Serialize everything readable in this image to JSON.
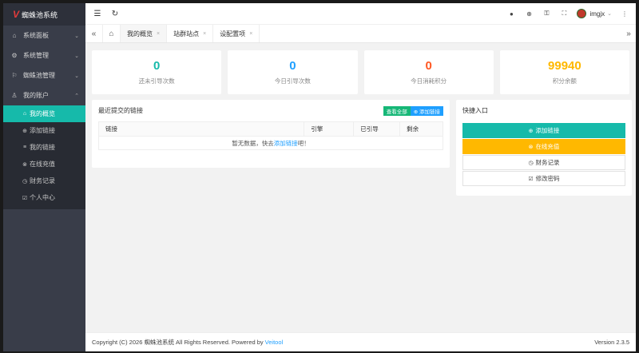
{
  "brand": {
    "logo_mark": "V",
    "name": "蜘蛛池系统"
  },
  "sidebar": {
    "items": [
      {
        "icon": "home-icon",
        "glyph": "⌂",
        "label": "系统面板",
        "arrow": "⌄"
      },
      {
        "icon": "gear-icon",
        "glyph": "⚙",
        "label": "系统管理",
        "arrow": "⌄"
      },
      {
        "icon": "flag-icon",
        "glyph": "⚐",
        "label": "蜘蛛池管理",
        "arrow": "⌄"
      },
      {
        "icon": "user-icon",
        "glyph": "♙",
        "label": "我的账户",
        "arrow": "⌃"
      }
    ],
    "sub_items": [
      {
        "glyph": "⌂",
        "label": "我的概览",
        "active": true
      },
      {
        "glyph": "⊕",
        "label": "添加链接"
      },
      {
        "glyph": "≡",
        "label": "我的链接"
      },
      {
        "glyph": "⊗",
        "label": "在线充值"
      },
      {
        "glyph": "◷",
        "label": "财务记录"
      },
      {
        "glyph": "☑",
        "label": "个人中心"
      }
    ]
  },
  "topbar": {
    "menu_glyph": "☰",
    "refresh_glyph": "↻",
    "right_icons": [
      "●",
      "⊕",
      "⚿",
      "⛶"
    ],
    "username": "imgjx",
    "more_glyph": "⋮"
  },
  "tabs": {
    "left_ctrl": "«",
    "home_glyph": "⌂",
    "items": [
      {
        "label": "我的概览",
        "active": true
      },
      {
        "label": "站群站点"
      },
      {
        "label": "设配置项"
      }
    ],
    "close_glyph": "×",
    "right_ctrl": "»"
  },
  "stats": [
    {
      "value": "0",
      "caption": "还未引导次数",
      "color": "#16baaa"
    },
    {
      "value": "0",
      "caption": "今日引导次数",
      "color": "#1e9fff"
    },
    {
      "value": "0",
      "caption": "今日消耗积分",
      "color": "#ff5722"
    },
    {
      "value": "99940",
      "caption": "积分余额",
      "color": "#ffb800"
    }
  ],
  "recent_links": {
    "title": "最近提交的链接",
    "view_all": "查看全部",
    "add_link": "⊕ 添加链接",
    "columns": [
      "链接",
      "引擎",
      "已引导",
      "剩余"
    ],
    "empty_prefix": "暂无数据，快去",
    "empty_link": "添加链接",
    "empty_suffix": "吧！"
  },
  "quick_entry": {
    "title": "快捷入口",
    "buttons": [
      {
        "glyph": "⊕",
        "label": "添加链接",
        "style": "qb-teal",
        "name": "quick-add-link-button"
      },
      {
        "glyph": "⊗",
        "label": "在线充值",
        "style": "qb-yellow",
        "name": "quick-recharge-button"
      },
      {
        "glyph": "◷",
        "label": "财务记录",
        "style": "qb-plain",
        "name": "quick-finance-button"
      },
      {
        "glyph": "☑",
        "label": "修改密码",
        "style": "qb-plain",
        "name": "quick-password-button"
      }
    ]
  },
  "footer": {
    "copyright": "Copyright (C) 2026 蜘蛛池系统 All Rights Reserved. Powered by ",
    "powered_link": "Veitool",
    "version": "Version 2.3.5"
  }
}
